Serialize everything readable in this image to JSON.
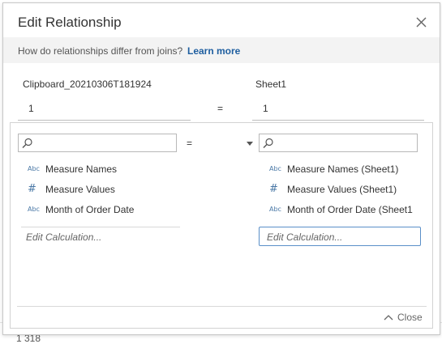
{
  "dialog": {
    "title": "Edit Relationship",
    "info_text": "How do relationships differ from joins?",
    "learn_more": "Learn more"
  },
  "relationship": {
    "left_source": "Clipboard_20210306T181924",
    "right_source": "Sheet1",
    "left_field": "1",
    "right_field": "1",
    "operator": "="
  },
  "picker": {
    "operator": "=",
    "left_search_value": "",
    "right_search_value": "",
    "left_fields": [
      {
        "icon": "Abc",
        "label": "Measure Names"
      },
      {
        "icon": "#",
        "label": "Measure Values"
      },
      {
        "icon": "Abc",
        "label": "Month of Order Date"
      }
    ],
    "right_fields": [
      {
        "icon": "Abc",
        "label": "Measure Names (Sheet1)"
      },
      {
        "icon": "#",
        "label": "Measure Values (Sheet1)"
      },
      {
        "icon": "Abc",
        "label": "Month of Order Date (Sheet1"
      }
    ],
    "edit_calc_left": "Edit Calculation...",
    "edit_calc_right": "Edit Calculation...",
    "close_label": "Close"
  },
  "background": {
    "partial_text": "1 318"
  },
  "colors": {
    "link": "#1f5fa0",
    "field_icon": "#4a78a6",
    "focus_border": "#5a8fc8"
  }
}
